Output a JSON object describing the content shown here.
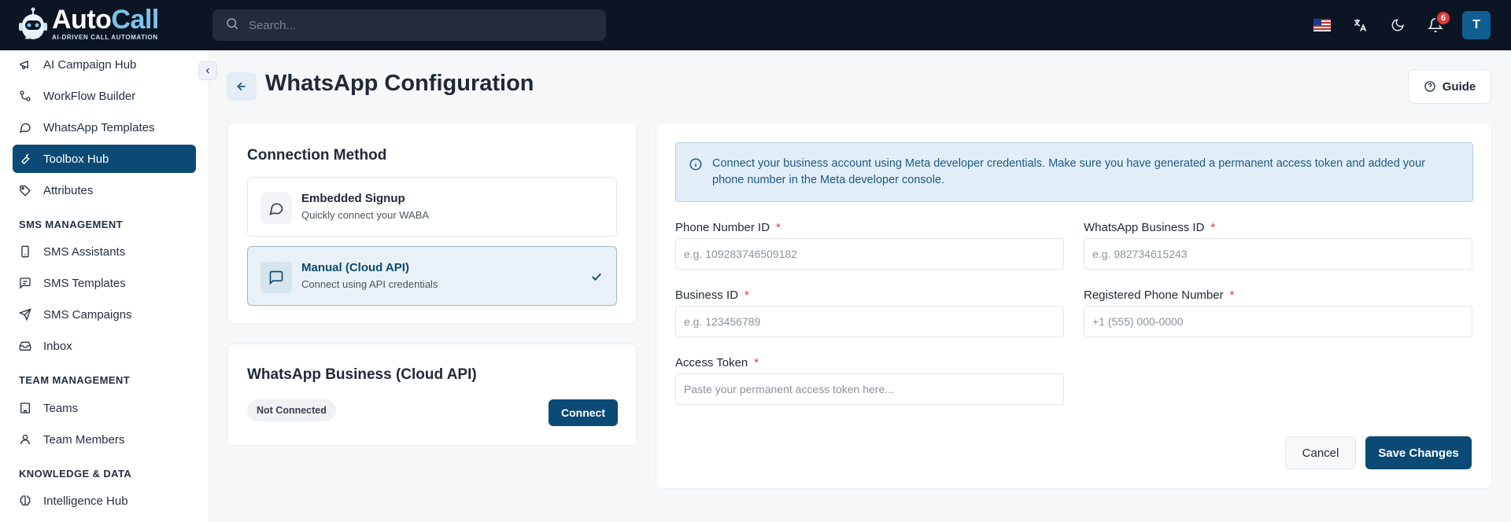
{
  "brand": {
    "name_part1": "Auto",
    "name_part2": "Call",
    "tagline": "AI-DRIVEN CALL AUTOMATION"
  },
  "search": {
    "placeholder": "Search..."
  },
  "topbar": {
    "notification_count": "6",
    "avatar_initial": "T"
  },
  "sidebar": {
    "items": [
      {
        "label": "AI Campaign Hub",
        "icon": "megaphone-icon"
      },
      {
        "label": "WorkFlow Builder",
        "icon": "workflow-icon"
      },
      {
        "label": "WhatsApp Templates",
        "icon": "chat-bubble-icon"
      },
      {
        "label": "Toolbox Hub",
        "icon": "wrench-icon",
        "active": true
      },
      {
        "label": "Attributes",
        "icon": "tag-icon"
      }
    ],
    "sms_section": "SMS MANAGEMENT",
    "sms_items": [
      {
        "label": "SMS Assistants",
        "icon": "phone-icon"
      },
      {
        "label": "SMS Templates",
        "icon": "message-icon"
      },
      {
        "label": "SMS Campaigns",
        "icon": "send-icon"
      },
      {
        "label": "Inbox",
        "icon": "inbox-icon"
      }
    ],
    "team_section": "TEAM MANAGEMENT",
    "team_items": [
      {
        "label": "Teams",
        "icon": "building-icon"
      },
      {
        "label": "Team Members",
        "icon": "user-icon"
      }
    ],
    "knowledge_section": "KNOWLEDGE & DATA",
    "knowledge_items": [
      {
        "label": "Intelligence Hub",
        "icon": "brain-icon"
      }
    ]
  },
  "page": {
    "title": "WhatsApp Configuration",
    "guide_label": "Guide"
  },
  "connection": {
    "title": "Connection Method",
    "methods": [
      {
        "title": "Embedded Signup",
        "subtitle": "Quickly connect your WABA"
      },
      {
        "title": "Manual (Cloud API)",
        "subtitle": "Connect using API credentials",
        "selected": true
      }
    ]
  },
  "business": {
    "title": "WhatsApp Business (Cloud API)",
    "status": "Not Connected",
    "connect_label": "Connect"
  },
  "form": {
    "info": "Connect your business account using Meta developer credentials. Make sure you have generated a permanent access token and added your phone number in the Meta developer console.",
    "fields": {
      "phone_number_id": {
        "label": "Phone Number ID",
        "placeholder": "e.g. 109283746509182"
      },
      "whatsapp_business_id": {
        "label": "WhatsApp Business ID",
        "placeholder": "e.g. 982734615243"
      },
      "business_id": {
        "label": "Business ID",
        "placeholder": "e.g. 123456789"
      },
      "registered_phone": {
        "label": "Registered Phone Number",
        "placeholder": "+1 (555) 000-0000"
      },
      "access_token": {
        "label": "Access Token",
        "placeholder": "Paste your permanent access token here..."
      }
    },
    "required_mark": "*",
    "cancel_label": "Cancel",
    "save_label": "Save Changes"
  }
}
